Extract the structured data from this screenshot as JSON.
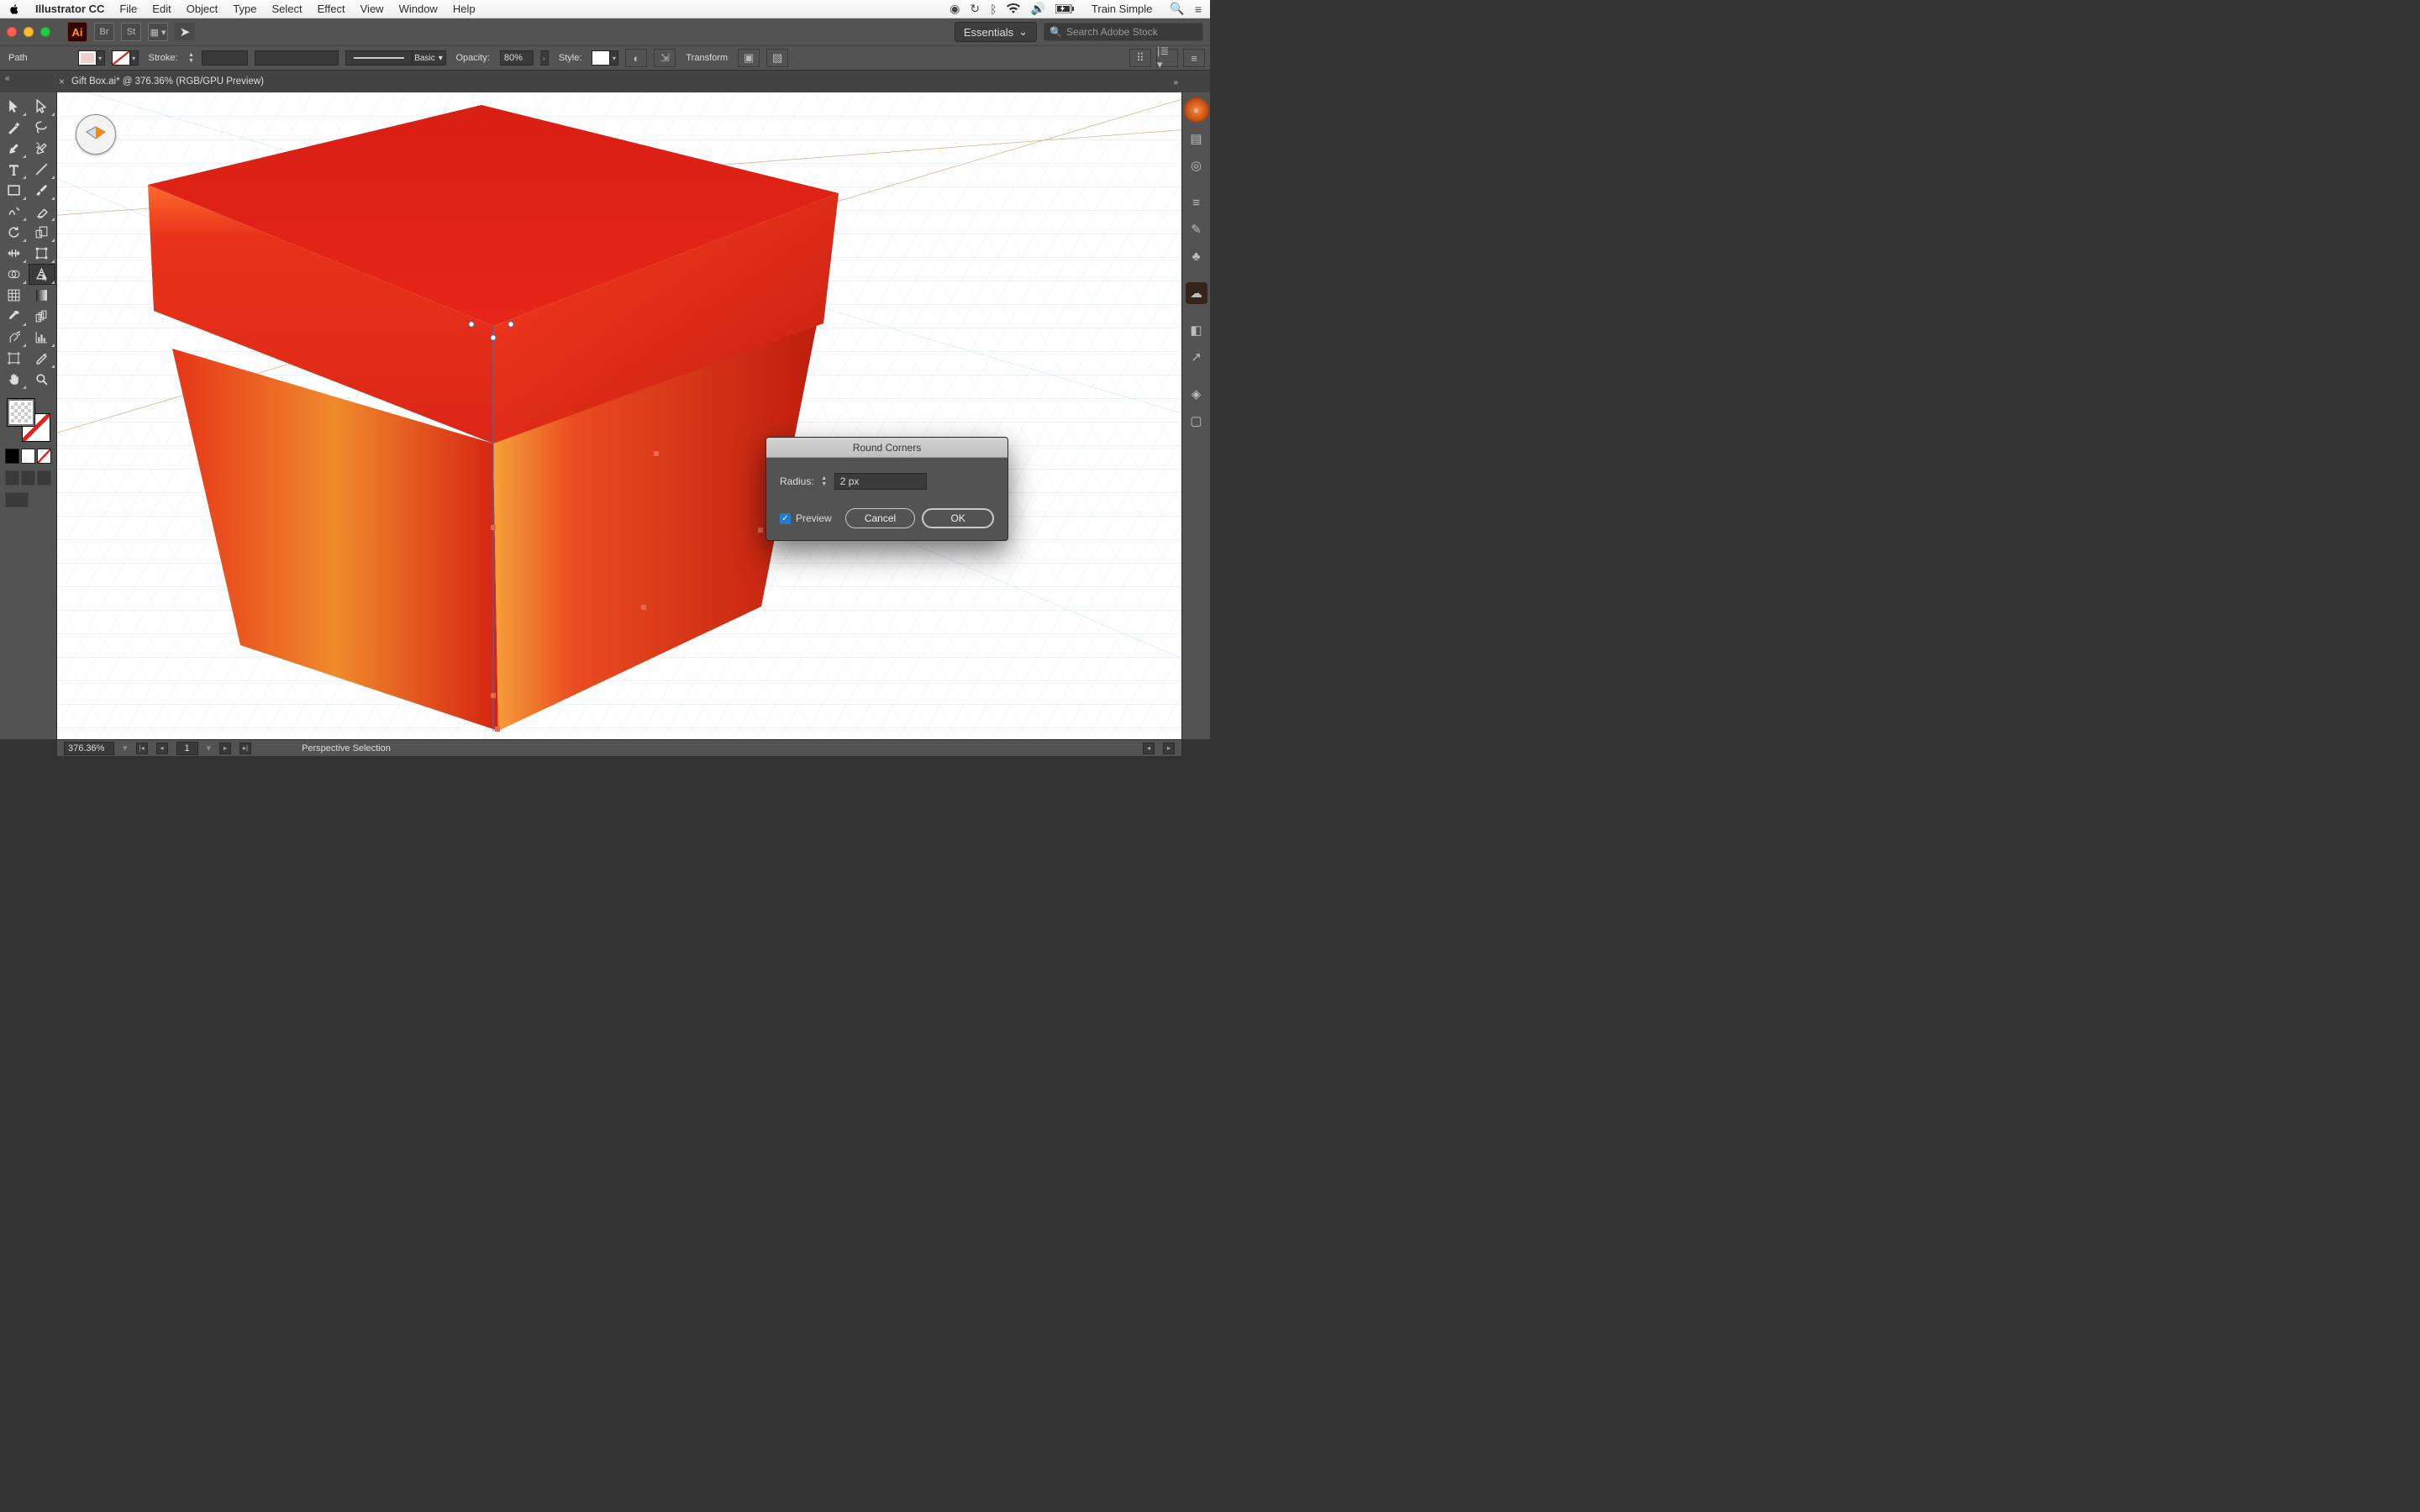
{
  "mac_menu": {
    "app_name": "Illustrator CC",
    "items": [
      "File",
      "Edit",
      "Object",
      "Type",
      "Select",
      "Effect",
      "View",
      "Window",
      "Help"
    ],
    "user": "Train Simple"
  },
  "app_bar": {
    "ai": "Ai",
    "br": "Br",
    "st": "St",
    "workspace": "Essentials",
    "search_placeholder": "Search Adobe Stock"
  },
  "control_bar": {
    "selection_label": "Path",
    "stroke_label": "Stroke:",
    "stroke_value": "",
    "brush_name": "Basic",
    "opacity_label": "Opacity:",
    "opacity_value": "80%",
    "style_label": "Style:",
    "transform_label": "Transform"
  },
  "document": {
    "tab_title": "Gift Box.ai* @ 376.36% (RGB/GPU Preview)"
  },
  "dialog": {
    "title": "Round Corners",
    "radius_label": "Radius:",
    "radius_value": "2 px",
    "preview_label": "Preview",
    "preview_checked": true,
    "cancel": "Cancel",
    "ok": "OK"
  },
  "status": {
    "zoom": "376.36%",
    "artboard": "1",
    "tool": "Perspective Selection"
  }
}
